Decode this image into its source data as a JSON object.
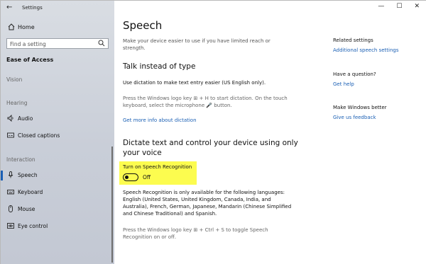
{
  "window": {
    "app_title": "Settings",
    "controls": {
      "minimize": "—",
      "maximize": "☐",
      "close": "✕"
    }
  },
  "sidebar": {
    "home_label": "Home",
    "search_placeholder": "Find a setting",
    "category": "Ease of Access",
    "sections": [
      {
        "heading": "Vision"
      },
      {
        "heading": "Hearing",
        "items": [
          {
            "label": "Audio",
            "icon": "speaker-icon"
          },
          {
            "label": "Closed captions",
            "icon": "captions-icon"
          }
        ]
      },
      {
        "heading": "Interaction",
        "items": [
          {
            "label": "Speech",
            "icon": "microphone-icon",
            "selected": true
          },
          {
            "label": "Keyboard",
            "icon": "keyboard-icon"
          },
          {
            "label": "Mouse",
            "icon": "mouse-icon"
          },
          {
            "label": "Eye control",
            "icon": "eye-icon"
          }
        ]
      }
    ]
  },
  "main": {
    "title": "Speech",
    "intro": "Make your device easier to use if you have limited reach or strength.",
    "dictation": {
      "heading": "Talk instead of type",
      "description": "Use dictation to make text entry easier (US English only).",
      "hint_line1": "Press the Windows logo key ⊞ + H to start dictation.  On the touch",
      "hint_line2": "keyboard, select the microphone 🎤 button.",
      "more_link": "Get more info about dictation"
    },
    "voice_control": {
      "heading_line1": "Dictate text and control your device using only",
      "heading_line2": "your voice",
      "toggle_label": "Turn on Speech Recognition",
      "toggle_state": "Off",
      "languages_line1": "Speech Recognition is only available for the following languages:",
      "languages_line2": "English (United States, United Kingdom, Canada, India, and",
      "languages_line3": "Australia), French, German, Japanese, Mandarin (Chinese Simplified",
      "languages_line4": "and Chinese Traditional) and Spanish.",
      "shortcut_line1": "Press the Windows logo key ⊞ + Ctrl + S to toggle Speech",
      "shortcut_line2": "Recognition on or off."
    }
  },
  "right_column": {
    "related_title": "Related settings",
    "related_link": "Additional speech settings",
    "question_title": "Have a question?",
    "question_link": "Get help",
    "better_title": "Make Windows better",
    "better_link": "Give us feedback"
  },
  "colors": {
    "accent": "#1a5fb4",
    "highlight": "#fcfc4f",
    "sidebar_bg": "#cdd2db"
  }
}
